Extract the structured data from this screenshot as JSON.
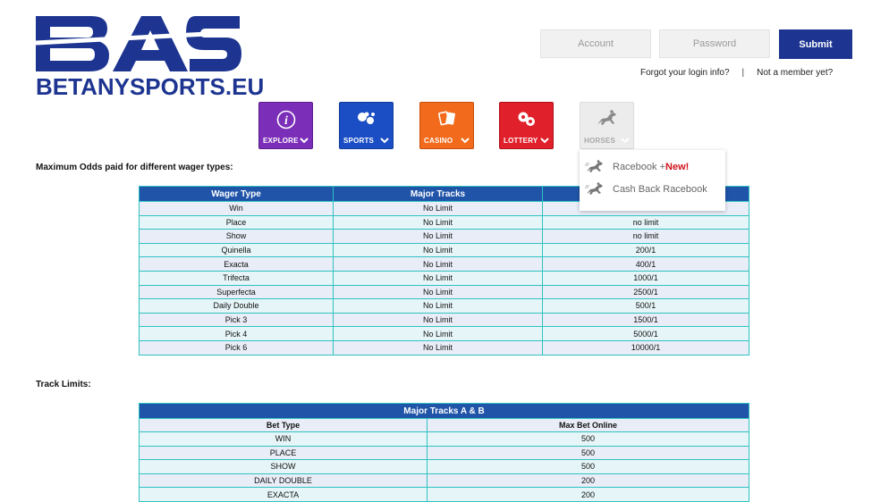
{
  "brand": {
    "logo_mark": "BAS",
    "logo_text": "BETANYSPORTS.EU",
    "color": "#1d3591"
  },
  "login": {
    "account_placeholder": "Account",
    "password_placeholder": "Password",
    "submit_label": "Submit",
    "forgot_link": "Forgot your login info?",
    "separator": "|",
    "signup_link": "Not a member yet?"
  },
  "nav": {
    "explore": {
      "label": "EXPLORE",
      "icon": "info-icon",
      "color": "#7b2eb8"
    },
    "sports": {
      "label": "SPORTS",
      "icon": "sports-balls-icon",
      "color": "#1b4ec4"
    },
    "casino": {
      "label": "CASINO",
      "icon": "cards-icon",
      "color": "#f26a1b"
    },
    "lottery": {
      "label": "LOTTERY",
      "icon": "lottery-balls-icon",
      "color": "#e0202a"
    },
    "horses": {
      "label": "HORSES",
      "icon": "horse-icon",
      "color": "#ececec"
    }
  },
  "horses_menu": {
    "item1": {
      "label": "Racebook + ",
      "badge": "New!"
    },
    "item2": {
      "label": "Cash Back Racebook"
    }
  },
  "odds": {
    "heading": "Maximum Odds paid for different wager types:",
    "headers": [
      "Wager Type",
      "Major Tracks",
      ""
    ],
    "rows": [
      [
        "Win",
        "No Limit",
        "no limit"
      ],
      [
        "Place",
        "No Limit",
        "no limit"
      ],
      [
        "Show",
        "No Limit",
        "no limit"
      ],
      [
        "Quinella",
        "No Limit",
        "200/1"
      ],
      [
        "Exacta",
        "No Limit",
        "400/1"
      ],
      [
        "Trifecta",
        "No Limit",
        "1000/1"
      ],
      [
        "Superfecta",
        "No Limit",
        "2500/1"
      ],
      [
        "Daily Double",
        "No Limit",
        "500/1"
      ],
      [
        "Pick 3",
        "No Limit",
        "1500/1"
      ],
      [
        "Pick 4",
        "No Limit",
        "5000/1"
      ],
      [
        "Pick 6",
        "No Limit",
        "10000/1"
      ]
    ]
  },
  "limits": {
    "heading": "Track Limits:",
    "title": "Major Tracks A & B",
    "headers": [
      "Bet Type",
      "Max Bet Online"
    ],
    "rows": [
      [
        "WIN",
        "500"
      ],
      [
        "PLACE",
        "500"
      ],
      [
        "SHOW",
        "500"
      ],
      [
        "DAILY DOUBLE",
        "200"
      ],
      [
        "EXACTA",
        "200"
      ]
    ]
  }
}
